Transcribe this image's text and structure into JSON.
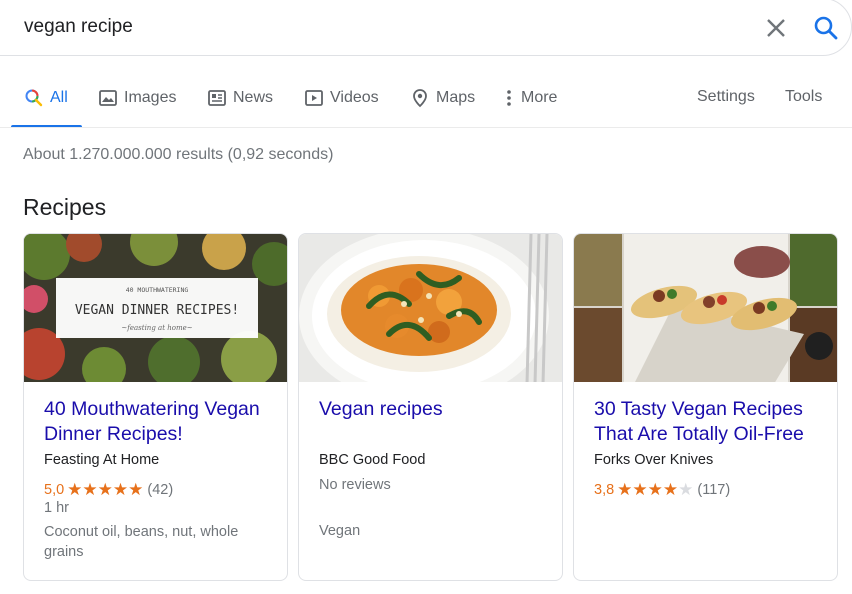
{
  "search": {
    "query": "vegan recipe"
  },
  "tabs": [
    {
      "label": "All",
      "icon": "search-icon",
      "active": true
    },
    {
      "label": "Images",
      "icon": "image-icon"
    },
    {
      "label": "News",
      "icon": "news-icon"
    },
    {
      "label": "Videos",
      "icon": "video-icon"
    },
    {
      "label": "Maps",
      "icon": "map-pin-icon"
    },
    {
      "label": "More",
      "icon": "more-vertical-icon"
    }
  ],
  "tools": {
    "settings": "Settings",
    "tools": "Tools"
  },
  "result_stats": "About 1.270.000.000 results (0,92 seconds)",
  "section_title": "Recipes",
  "cards": [
    {
      "image_overlay_top": "40 MOUTHWATERING",
      "image_overlay_main": "VEGAN DINNER RECIPES!",
      "image_overlay_sub": "~feasting at home~",
      "title": "40 Mouthwatering Vegan Dinner Recipes!",
      "source": "Feasting At Home",
      "rating": "5,0",
      "stars": 5,
      "reviews": "(42)",
      "time": "1 hr",
      "ingredients": "Coconut oil, beans, nut, whole grains"
    },
    {
      "title": "Vegan recipes",
      "source": "BBC Good Food",
      "no_reviews": "No reviews",
      "category": "Vegan"
    },
    {
      "title": "30 Tasty Vegan Recipes That Are Totally Oil-Free",
      "source": "Forks Over Knives",
      "rating": "3,8",
      "stars": 4,
      "reviews": "(117)"
    }
  ],
  "colors": {
    "accent": "#1a73e8",
    "link": "#1a0dab",
    "star": "#e7711b"
  }
}
